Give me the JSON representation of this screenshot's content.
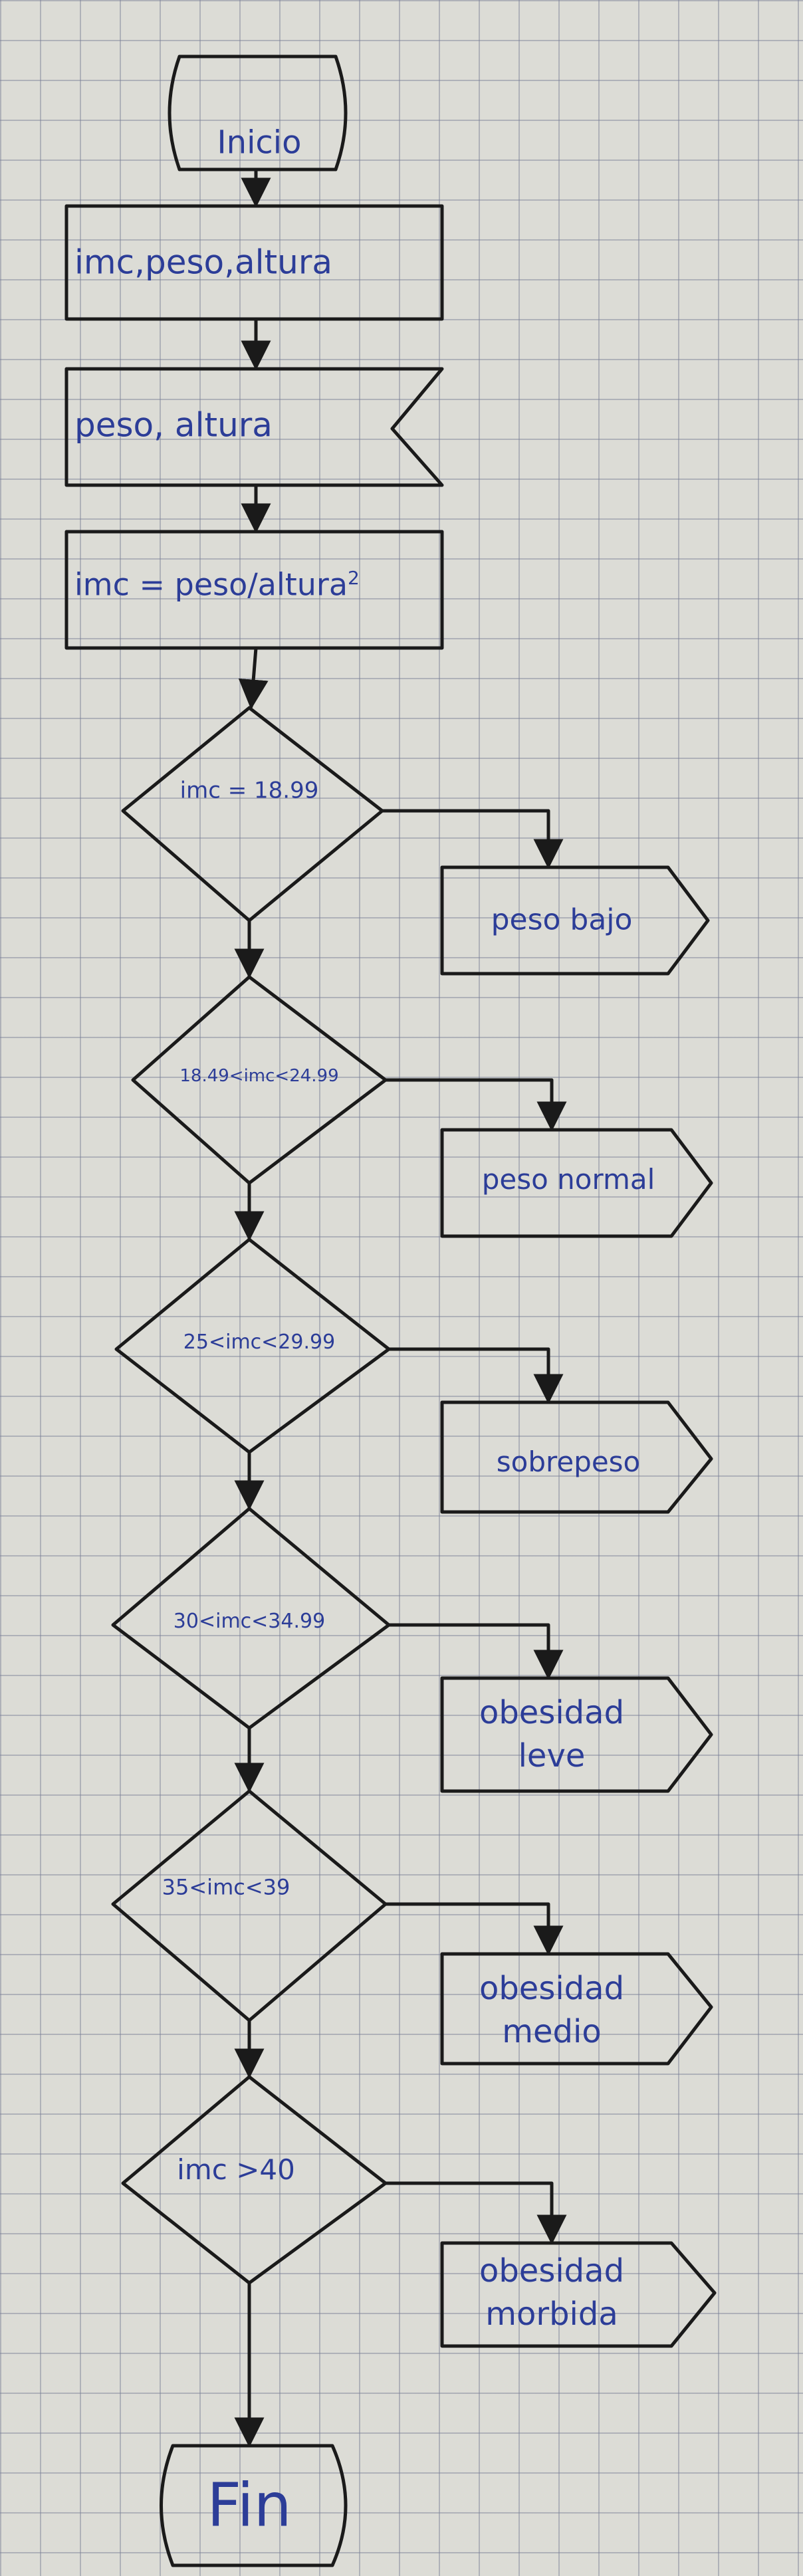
{
  "flowchart": {
    "start": "Inicio",
    "declare": "imc,peso,altura",
    "input": "peso, altura",
    "compute": "imc = peso/altura",
    "compute_sup": "2",
    "decisions": [
      {
        "label": "imc = 18.99",
        "result": "peso bajo"
      },
      {
        "label": "18.49<imc<24.99",
        "result": "peso normal"
      },
      {
        "label": "25<imc<29.99",
        "result": "sobrepeso"
      },
      {
        "label": "30<imc<34.99",
        "result": "obesidad leve"
      },
      {
        "label": "35<imc<39",
        "result": "obesidad medio"
      },
      {
        "label": "imc >40",
        "result": "obesidad morbida"
      }
    ],
    "end": "Fin"
  },
  "colors": {
    "ink": "#1a1a1a",
    "pen": "#2c3d98",
    "paper": "#dcdcd6"
  }
}
